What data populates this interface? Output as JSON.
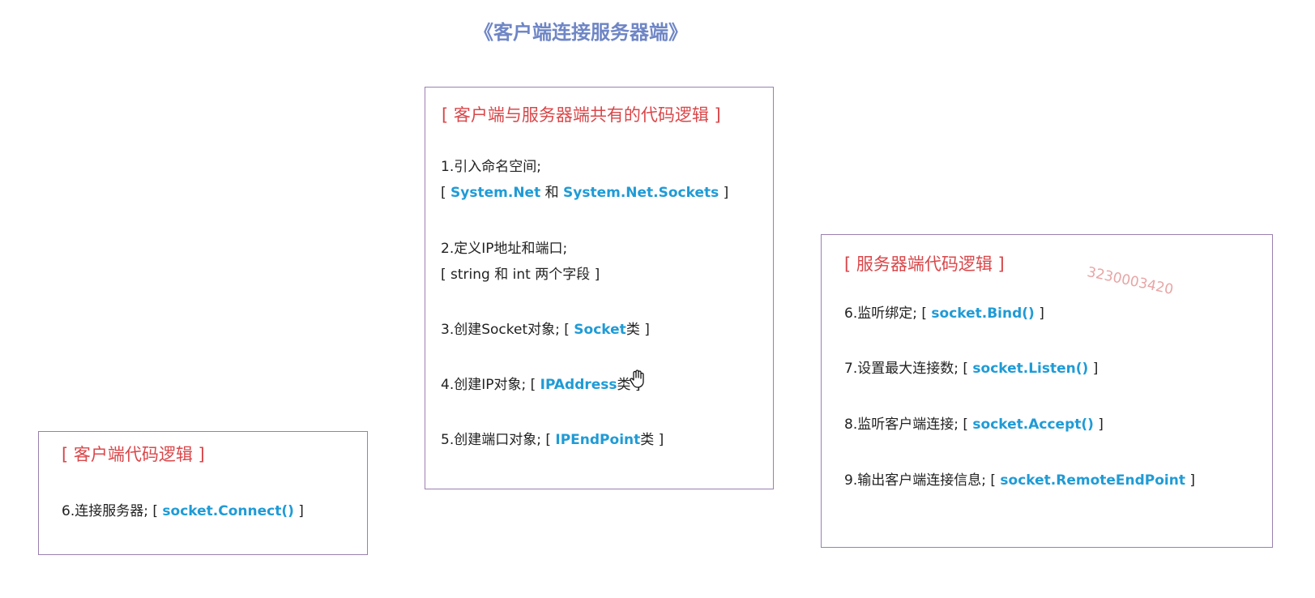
{
  "title": "《客户端连接服务器端》",
  "watermark": "3230003420",
  "shared_box": {
    "heading": "[ 客户端与服务器端共有的代码逻辑 ]",
    "steps": [
      {
        "text": "1.引入命名空间;"
      },
      {
        "pre": "[ ",
        "code1": "System.Net",
        "mid": " 和 ",
        "code2": "System.Net.Sockets",
        "post": " ]"
      },
      {
        "text": "2.定义IP地址和端口;"
      },
      {
        "text": "[ string 和 int 两个字段 ]"
      },
      {
        "pre": "3.创建Socket对象;   [ ",
        "code": "Socket",
        "post": "类 ]"
      },
      {
        "pre": "4.创建IP对象;    [ ",
        "code": "IPAddress",
        "post": "类 ]"
      },
      {
        "pre": "5.创建端口对象;  [ ",
        "code": "IPEndPoint",
        "post": "类 ]"
      }
    ]
  },
  "server_box": {
    "heading": "[ 服务器端代码逻辑 ]",
    "steps": [
      {
        "pre": "6.监听绑定; [ ",
        "code": "socket.Bind()",
        "post": " ]"
      },
      {
        "pre": "7.设置最大连接数; [ ",
        "code": "socket.Listen()",
        "post": " ]"
      },
      {
        "pre": "8.监听客户端连接; [ ",
        "code": "socket.Accept()",
        "post": " ]"
      },
      {
        "pre": "9.输出客户端连接信息; [ ",
        "code": "socket.RemoteEndPoint",
        "post": " ]"
      }
    ]
  },
  "client_box": {
    "heading": "[ 客户端代码逻辑 ]",
    "steps": [
      {
        "pre": "6.连接服务器; [ ",
        "code": "socket.Connect()",
        "post": " ]"
      }
    ]
  },
  "colors": {
    "title": "#6f86c6",
    "heading": "#d9474a",
    "code": "#1f9bd6",
    "border": "#9a7fb0",
    "watermark": "#e8a5a5"
  },
  "icons": {
    "cursor": "hand-cursor-icon"
  }
}
